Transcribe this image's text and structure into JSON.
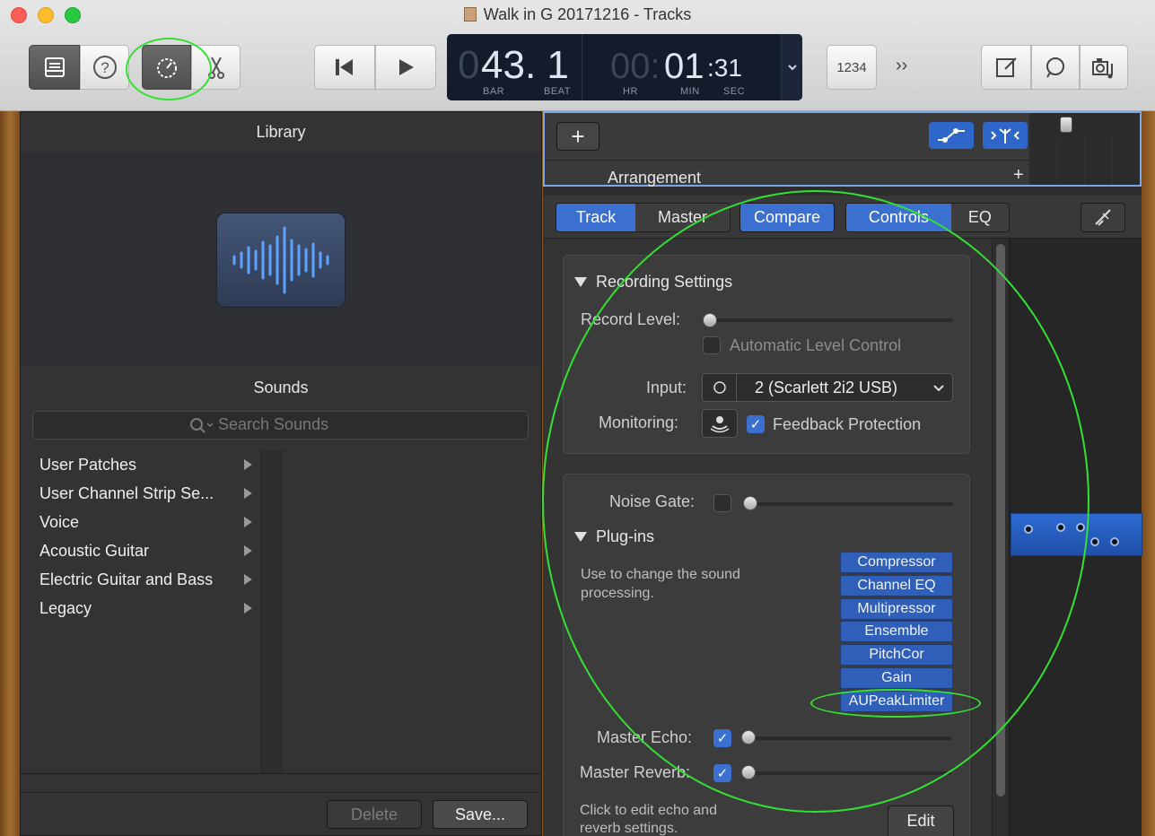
{
  "window": {
    "title": "Walk in G 20171216 - Tracks"
  },
  "toolbar": {
    "library_icon": "library-icon",
    "help_icon": "help-icon",
    "smart_controls_icon": "smart-controls-icon",
    "editors_icon": "scissors-icon",
    "rewind_icon": "rewind-icon",
    "play_icon": "play-icon",
    "count_in_label": "1234",
    "overflow_label": "››",
    "notepad_icon": "notepad-icon",
    "loop_browser_icon": "loop-icon",
    "media_browser_icon": "media-icon"
  },
  "lcd": {
    "position_prefix": "0",
    "position": "43. 1",
    "bar_label": "BAR",
    "beat_label": "BEAT",
    "hours": "00:",
    "minutes": "01",
    "seconds": ":31",
    "hr_label": "HR",
    "min_label": "MIN",
    "sec_label": "SEC"
  },
  "library": {
    "header": "Library",
    "sounds_header": "Sounds",
    "search_placeholder": "Search Sounds",
    "items": [
      {
        "label": "User Patches"
      },
      {
        "label": "User Channel Strip Se..."
      },
      {
        "label": "Voice"
      },
      {
        "label": "Acoustic Guitar"
      },
      {
        "label": "Electric Guitar and Bass"
      },
      {
        "label": "Legacy"
      }
    ],
    "delete_label": "Delete",
    "save_label": "Save..."
  },
  "tracks": {
    "add_label": "+",
    "arrangement_label": "Arrangement",
    "arrangement_add": "+"
  },
  "smart_controls": {
    "tabs_left": [
      "Track",
      "Master"
    ],
    "compare_label": "Compare",
    "tabs_right": [
      "Controls",
      "EQ"
    ],
    "recording": {
      "title": "Recording Settings",
      "record_level_label": "Record Level:",
      "record_level_value": 0,
      "auto_level_label": "Automatic Level Control",
      "auto_level_checked": false,
      "input_label": "Input:",
      "input_value": "2  (Scarlett 2i2 USB)",
      "monitoring_label": "Monitoring:",
      "feedback_label": "Feedback Protection",
      "feedback_checked": true
    },
    "noise_gate_label": "Noise Gate:",
    "plugins_title": "Plug-ins",
    "plugins_help": "Use to change the sound processing.",
    "plugins": [
      "Compressor",
      "Channel EQ",
      "Multipressor",
      "Ensemble",
      "PitchCor",
      "Gain",
      "AUPeakLimiter"
    ],
    "master_echo_label": "Master Echo:",
    "master_echo_checked": true,
    "master_reverb_label": "Master Reverb:",
    "master_reverb_checked": true,
    "edit_help": "Click to edit echo and reverb settings.",
    "edit_label": "Edit"
  },
  "colors": {
    "accent": "#3b6fd0",
    "annotation": "#33e033"
  }
}
